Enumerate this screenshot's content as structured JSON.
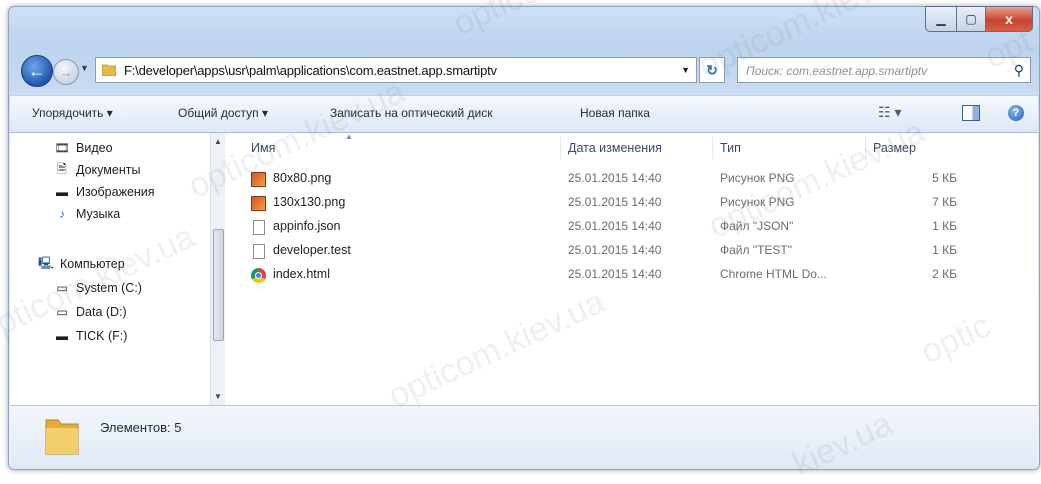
{
  "window": {
    "close_glyph": "x"
  },
  "nav": {
    "address_path": "F:\\developer\\apps\\usr\\palm\\applications\\com.eastnet.app.smartiptv",
    "search_placeholder": "Поиск: com.eastnet.app.smartiptv"
  },
  "toolbar": {
    "organize": "Упорядочить ▾",
    "share": "Общий доступ ▾",
    "burn": "Записать на оптический диск",
    "new_folder": "Новая папка"
  },
  "navpane": {
    "items": [
      {
        "label": "Видео",
        "icon": "video-icon"
      },
      {
        "label": "Документы",
        "icon": "documents-icon"
      },
      {
        "label": "Изображения",
        "icon": "pictures-icon"
      },
      {
        "label": "Музыка",
        "icon": "music-icon"
      },
      {
        "label": "Компьютер",
        "icon": "computer-icon"
      },
      {
        "label": "System (C:)",
        "icon": "system-drive-icon"
      },
      {
        "label": "Data (D:)",
        "icon": "drive-icon"
      },
      {
        "label": "TICK (F:)",
        "icon": "usb-drive-icon"
      }
    ]
  },
  "filelist": {
    "columns": {
      "name": "Имя",
      "date": "Дата изменения",
      "type": "Тип",
      "size": "Размер"
    },
    "rows": [
      {
        "name": "80x80.png",
        "date": "25.01.2015 14:40",
        "type": "Рисунок PNG",
        "size": "5 КБ",
        "icon": "png-file-icon"
      },
      {
        "name": "130x130.png",
        "date": "25.01.2015 14:40",
        "type": "Рисунок PNG",
        "size": "7 КБ",
        "icon": "png-file-icon"
      },
      {
        "name": "appinfo.json",
        "date": "25.01.2015 14:40",
        "type": "Файл \"JSON\"",
        "size": "1 КБ",
        "icon": "json-file-icon"
      },
      {
        "name": "developer.test",
        "date": "25.01.2015 14:40",
        "type": "Файл \"TEST\"",
        "size": "1 КБ",
        "icon": "test-file-icon"
      },
      {
        "name": "index.html",
        "date": "25.01.2015 14:40",
        "type": "Chrome HTML Do...",
        "size": "2 КБ",
        "icon": "chrome-html-icon"
      }
    ]
  },
  "details": {
    "count_label": "Элементов: 5"
  },
  "watermarks": [
    "opticom",
    "opticom.kiev.ua",
    "opticom.kiev.ua",
    "opticom.kiev.ua",
    "opticom.kiev.ua",
    "optic",
    "opticom.kiev.ua",
    "opt",
    "kiev.ua"
  ]
}
